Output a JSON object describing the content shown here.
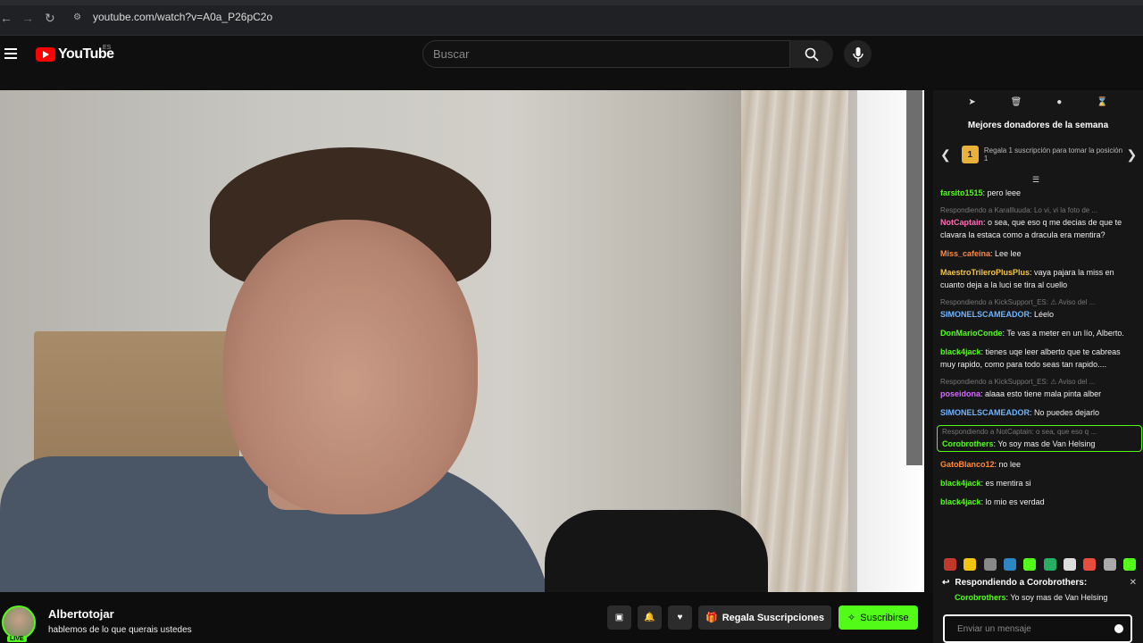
{
  "browser": {
    "url": "youtube.com/watch?v=A0a_P26pC2o"
  },
  "header": {
    "logo_text": "YouTube",
    "region": "ES",
    "search_placeholder": "Buscar"
  },
  "chat": {
    "donors_title": "Mejores donadores de la semana",
    "donor_position": "1",
    "donor_text": "Regala 1 suscripción para tomar la posición 1",
    "messages": [
      {
        "reply": "",
        "user": "farsito1515",
        "color": "#53fc18",
        "text": ": pero leee"
      },
      {
        "reply": "Respondiendo a Karallluuda: Lo vi, vi la foto de ...",
        "user": "NotCaptain",
        "color": "#ff6eb4",
        "text": ": o sea, que eso q me decias de que te clavara la estaca como a dracula era mentira?"
      },
      {
        "reply": "",
        "user": "Miss_cafeina",
        "color": "#ff8a3d",
        "text": ": Lee lee"
      },
      {
        "reply": "",
        "user": "MaestroTrileroPlusPlus",
        "color": "#f5c542",
        "text": ": vaya pajara la miss en cuanto deja a la luci se tira al cuello"
      },
      {
        "reply": "Respondiendo a KickSupport_ES: ⚠ Aviso del ...",
        "user": "SIMONELSCAMEADOR",
        "color": "#6fb4ff",
        "text": ": Léelo"
      },
      {
        "reply": "",
        "user": "DonMarioConde",
        "color": "#53fc18",
        "text": ": Te vas a meter en un lío, Alberto."
      },
      {
        "reply": "",
        "user": "black4jack",
        "color": "#53fc18",
        "text": ": tienes uqe leer alberto que te cabreas muy rapido, como para todo seas tan rapido...."
      },
      {
        "reply": "Respondiendo a KickSupport_ES: ⚠ Aviso del ...",
        "user": "poseidona",
        "color": "#d36bff",
        "text": ": alaaa esto tiene mala pinta alber"
      },
      {
        "reply": "",
        "user": "SIMONELSCAMEADOR",
        "color": "#6fb4ff",
        "text": ": No puedes dejarlo"
      },
      {
        "reply": "Respondiendo a NotCaptain: o sea, que eso q ...",
        "user": "Corobrothers",
        "color": "#53fc18",
        "text": ": Yo soy mas de Van Helsing",
        "highlight": true
      },
      {
        "reply": "",
        "user": "GatoBlanco12",
        "color": "#ff8a3d",
        "text": ": no lee"
      },
      {
        "reply": "",
        "user": "black4jack",
        "color": "#53fc18",
        "text": ": es mentira si"
      },
      {
        "reply": "",
        "user": "black4jack",
        "color": "#53fc18",
        "text": ": lo mio es verdad"
      }
    ],
    "reply_header": "Respondiendo a Corobrothers:",
    "reply_user": "Corobrothers",
    "reply_text": ": Yo soy mas de Van Helsing",
    "input_placeholder": "Enviar un mensaje"
  },
  "channel": {
    "name": "Albertotojar",
    "title": "hablemos de lo que querais ustedes",
    "live_badge": "LIVE",
    "gift_label": "Regala Suscripciones",
    "subscribe_label": "Suscribirse"
  },
  "colors": {
    "kick_green": "#53fc18",
    "youtube_red": "#ff0000"
  }
}
